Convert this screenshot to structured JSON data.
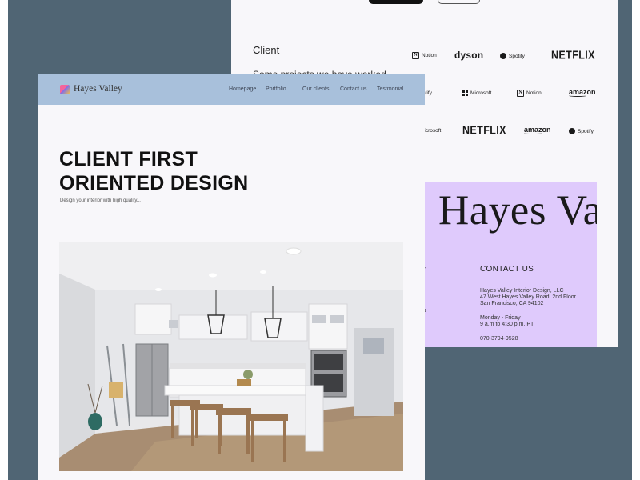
{
  "back_page": {
    "client_heading": "Client",
    "client_subtitle": "Some projects we have worked",
    "logos_row1": [
      {
        "name": "Notion",
        "icon": "notion-icon",
        "style": "notion"
      },
      {
        "name": "dyson",
        "style": "dyson"
      },
      {
        "name": "Spotify",
        "icon": "spotify-icon",
        "style": "spotify"
      },
      {
        "name": "NETFLIX",
        "style": "netflix"
      }
    ],
    "logos_row2": [
      {
        "name": "Spotify",
        "style": "spotify"
      },
      {
        "name": "Microsoft",
        "icon": "microsoft-icon",
        "style": "ms"
      },
      {
        "name": "Notion",
        "icon": "notion-icon",
        "style": "notion"
      },
      {
        "name": "amazon",
        "style": "amazon"
      }
    ],
    "logos_row3": [
      {
        "name": "Microsoft",
        "style": "ms"
      },
      {
        "name": "NETFLIX",
        "style": "netflix"
      },
      {
        "name": "amazon",
        "style": "amazon"
      },
      {
        "name": "Spotify",
        "icon": "spotify-icon",
        "style": "spotify"
      }
    ]
  },
  "footer": {
    "big_brand": "Hayes Valley",
    "left_column_fragments": [
      "E",
      "ils"
    ],
    "contact_heading": "CONTACT US",
    "address": [
      "Hayes Valley Interior Design, LLC",
      "47 West Hayes Valley Road, 2nd Floor",
      "San Francisco, CA 94102"
    ],
    "hours": [
      "Monday - Friday",
      "9 a.m to 4:30 p.m, PT."
    ],
    "phone": "070-3794-9528",
    "background_color": "#dfcafc"
  },
  "front_page": {
    "brand_name": "Hayes Valley",
    "nav": [
      "Homepage",
      "Portfolio",
      "Our clients",
      "Contact us",
      "Testmonial"
    ],
    "nav_color": "#a8c0db",
    "hero_title_line1": "CLIENT FIRST",
    "hero_title_line2": "ORIENTED DESIGN",
    "hero_subtitle": "Design your interior with high quality..."
  }
}
